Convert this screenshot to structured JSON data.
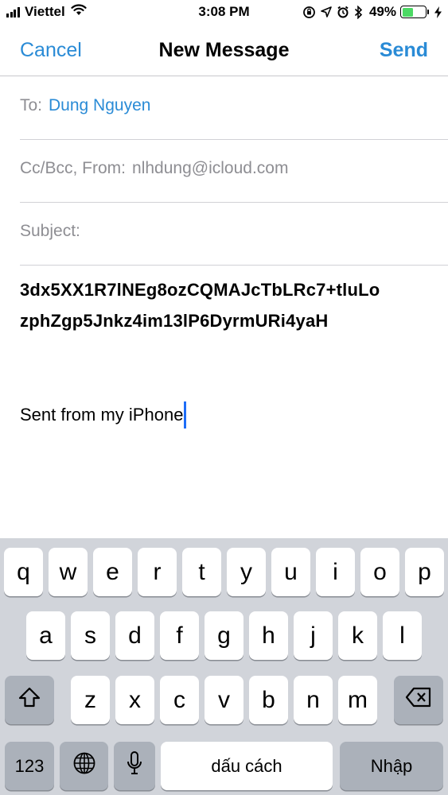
{
  "status_bar": {
    "carrier": "Viettel",
    "time": "3:08 PM",
    "battery_percent": "49%",
    "battery_level": 0.49,
    "icons": [
      "signal-bars-icon",
      "wifi-icon",
      "orientation-lock-icon",
      "location-arrow-icon",
      "alarm-icon",
      "bluetooth-icon",
      "battery-icon",
      "charging-bolt-icon"
    ]
  },
  "nav": {
    "cancel_label": "Cancel",
    "title": "New Message",
    "send_label": "Send"
  },
  "compose": {
    "to_label": "To:",
    "to_value": "Dung Nguyen",
    "ccbcc_label": "Cc/Bcc, From:",
    "from_value": "nlhdung@icloud.com",
    "subject_label": "Subject:",
    "subject_value": "",
    "body_line1": "3dx5XX1R7lNEg8ozCQMAJcTbLRc7+tluLo",
    "body_line2": "zphZgp5Jnkz4im13lP6DyrmURi4yaH",
    "signature": "Sent from my iPhone"
  },
  "keyboard": {
    "row1": [
      "q",
      "w",
      "e",
      "r",
      "t",
      "y",
      "u",
      "i",
      "o",
      "p"
    ],
    "row2": [
      "a",
      "s",
      "d",
      "f",
      "g",
      "h",
      "j",
      "k",
      "l"
    ],
    "row3": [
      "z",
      "x",
      "c",
      "v",
      "b",
      "n",
      "m"
    ],
    "numbers_label": "123",
    "space_label": "dấu cách",
    "return_label": "Nhập",
    "colors": {
      "background": "#d1d4da",
      "key": "#ffffff",
      "special_key": "#abb1ba"
    }
  },
  "colors": {
    "accent": "#2a8bd6",
    "caret": "#1e6df7",
    "battery_fill": "#4cd964"
  }
}
